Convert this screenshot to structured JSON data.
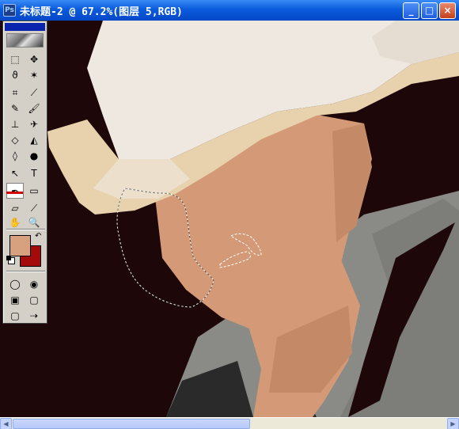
{
  "window": {
    "title": "未标题-2 @ 67.2%(图层 5,RGB)",
    "app_icon": "photoshop-icon",
    "buttons": {
      "minimize": "_",
      "maximize": "□",
      "close": "×"
    }
  },
  "toolbox": {
    "tools": [
      {
        "name": "marquee-tool",
        "glyph": "⬚"
      },
      {
        "name": "move-tool",
        "glyph": "✥"
      },
      {
        "name": "lasso-tool",
        "glyph": "ϑ"
      },
      {
        "name": "magic-wand-tool",
        "glyph": "✶"
      },
      {
        "name": "crop-tool",
        "glyph": "⌗"
      },
      {
        "name": "slice-tool",
        "glyph": "⟋"
      },
      {
        "name": "healing-brush-tool",
        "glyph": "✎"
      },
      {
        "name": "brush-tool",
        "glyph": "🖌"
      },
      {
        "name": "clone-stamp-tool",
        "glyph": "⊥"
      },
      {
        "name": "history-brush-tool",
        "glyph": "✈"
      },
      {
        "name": "eraser-tool",
        "glyph": "◇"
      },
      {
        "name": "paint-bucket-tool",
        "glyph": "◭"
      },
      {
        "name": "blur-tool",
        "glyph": "◊"
      },
      {
        "name": "dodge-tool",
        "glyph": "●"
      },
      {
        "name": "path-selection-tool",
        "glyph": "↖"
      },
      {
        "name": "type-tool",
        "glyph": "T"
      },
      {
        "name": "pen-tool",
        "glyph": "✒"
      },
      {
        "name": "rectangle-tool",
        "glyph": "▭"
      },
      {
        "name": "notes-tool",
        "glyph": "▱"
      },
      {
        "name": "eyedropper-tool",
        "glyph": "⟋"
      },
      {
        "name": "hand-tool",
        "glyph": "✋"
      },
      {
        "name": "zoom-tool",
        "glyph": "🔍"
      },
      {
        "name": "standard-mode-button",
        "glyph": "◯"
      },
      {
        "name": "quickmask-mode-button",
        "glyph": "◉"
      },
      {
        "name": "screen-mode-1-button",
        "glyph": "▣"
      },
      {
        "name": "screen-mode-2-button",
        "glyph": "▢"
      },
      {
        "name": "screen-mode-3-button",
        "glyph": "▢"
      },
      {
        "name": "jump-to-imageready-button",
        "glyph": "⇢"
      }
    ],
    "colors": {
      "foreground": "#d7a07f",
      "background": "#a50a0a"
    }
  },
  "canvas_colors": {
    "backdrop": "#1d0708",
    "hat": "#efe8e0",
    "hat_brim": "#e8d2ad",
    "skin": "#d49a77",
    "skin_shadow": "#c48a68",
    "jacket": "#8a8a86",
    "jacket_dark": "#2a2a2a"
  }
}
